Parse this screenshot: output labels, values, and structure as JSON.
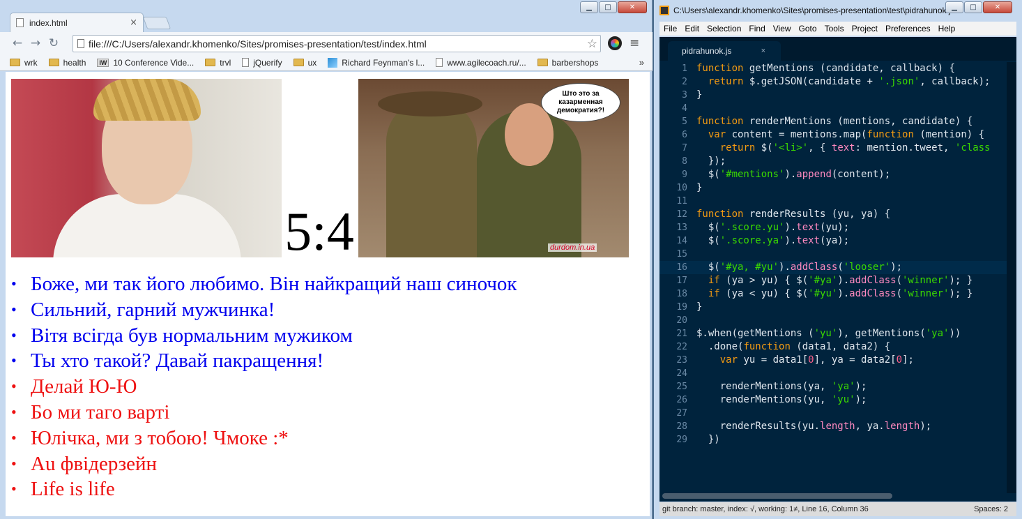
{
  "browser": {
    "tab_title": "index.html",
    "tab_close": "×",
    "url": "file:///C:/Users/alexandr.khomenko/Sites/promises-presentation/test/index.html",
    "bookmarks": [
      "wrk",
      "health",
      "10 Conference Vide...",
      "trvl",
      "jQuerify",
      "ux",
      "Richard Feynman's l...",
      "www.agilecoach.ru/...",
      "barbershops"
    ],
    "bookmark_iw": "IW",
    "bookmarks_more": "»",
    "win_min": "▁",
    "win_max": "□",
    "win_close": "✕"
  },
  "page": {
    "bubble_text": "Што это за казарменная демократия?!",
    "watermark": "durdom.in.ua",
    "score_yu": "5",
    "score_sep": ":",
    "score_ya": "4",
    "bullet": "•",
    "mentions": [
      {
        "text": "Боже, ми так його любимо. Він найкращий наш синочок",
        "status": "winner"
      },
      {
        "text": "Сильний, гарний мужчинка!",
        "status": "winner"
      },
      {
        "text": "Вітя всігда був нормальним мужиком",
        "status": "winner"
      },
      {
        "text": "Ты хто такой? Давай пакращення!",
        "status": "winner"
      },
      {
        "text": "Делай Ю-Ю",
        "status": "looser"
      },
      {
        "text": "Бо ми таго варті",
        "status": "looser"
      },
      {
        "text": "Юлічка, ми з тобою! Чмоке :*",
        "status": "looser"
      },
      {
        "text": "Au фвідерзейн",
        "status": "looser"
      },
      {
        "text": "Life is life",
        "status": "looser"
      }
    ]
  },
  "editor": {
    "title": "C:\\Users\\alexandr.khomenko\\Sites\\promises-presentation\\test\\pidrahunok.js",
    "menu": [
      "File",
      "Edit",
      "Selection",
      "Find",
      "View",
      "Goto",
      "Tools",
      "Project",
      "Preferences",
      "Help"
    ],
    "tab": "pidrahunok.js",
    "tab_close": "×",
    "active_line": 16,
    "lines": [
      "function getMentions (candidate, callback) {",
      "  return $.getJSON(candidate + '.json', callback);",
      "}",
      "",
      "function renderMentions (mentions, candidate) {",
      "  var content = mentions.map(function (mention) {",
      "    return $('<li>', { text: mention.tweet, 'class",
      "  });",
      "  $('#mentions').append(content);",
      "}",
      "",
      "function renderResults (yu, ya) {",
      "  $('.score.yu').text(yu);",
      "  $('.score.ya').text(ya);",
      "",
      "  $('#ya, #yu').addClass('looser');",
      "  if (ya > yu) { $('#ya').addClass('winner'); }",
      "  if (ya < yu) { $('#yu').addClass('winner'); }",
      "}",
      "",
      "$.when(getMentions ('yu'), getMentions('ya'))",
      "  .done(function (data1, data2) {",
      "    var yu = data1[0], ya = data2[0];",
      "",
      "    renderMentions(ya, 'ya');",
      "    renderMentions(yu, 'yu');",
      "",
      "    renderResults(yu.length, ya.length);",
      "  })"
    ],
    "status_left": "git branch: master, index: √, working: 1≠, Line 16, Column 36",
    "status_right": "Spaces: 2"
  },
  "colors": {
    "winner": "#0000ee",
    "looser": "#ee1111",
    "editor_bg": "#00233d",
    "keyword": "#f39c12",
    "string": "#3ad900"
  }
}
